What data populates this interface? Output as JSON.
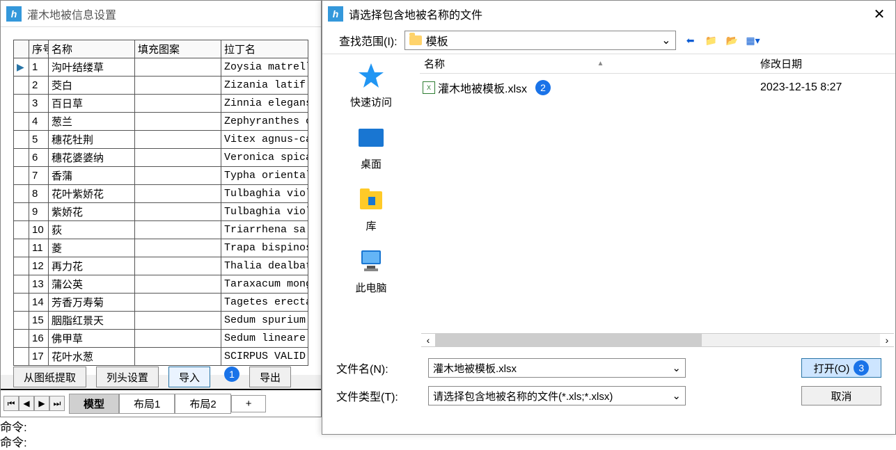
{
  "main_window": {
    "title": "灌木地被信息设置",
    "columns": {
      "index": "序号",
      "name": "名称",
      "fill": "填充图案",
      "latin": "拉丁名"
    },
    "rows": [
      {
        "idx": "1",
        "name": "沟叶结缕草",
        "latin": "Zoysia matrell"
      },
      {
        "idx": "2",
        "name": "茭白",
        "latin": "Zizania latif"
      },
      {
        "idx": "3",
        "name": "百日草",
        "latin": "Zinnia elegans"
      },
      {
        "idx": "4",
        "name": "葱兰",
        "latin": "Zephyranthes c"
      },
      {
        "idx": "5",
        "name": "穗花牡荆",
        "latin": "Vitex agnus-ca"
      },
      {
        "idx": "6",
        "name": "穗花婆婆纳",
        "latin": "Veronica spica"
      },
      {
        "idx": "7",
        "name": "香蒲",
        "latin": "Typha oriental"
      },
      {
        "idx": "8",
        "name": "花叶紫娇花",
        "latin": "Tulbaghia viol"
      },
      {
        "idx": "9",
        "name": "紫娇花",
        "latin": "Tulbaghia viol"
      },
      {
        "idx": "10",
        "name": "荻",
        "latin": "Triarrhena sa"
      },
      {
        "idx": "11",
        "name": "菱",
        "latin": "Trapa bispinos"
      },
      {
        "idx": "12",
        "name": "再力花",
        "latin": "Thalia dealbat"
      },
      {
        "idx": "13",
        "name": "蒲公英",
        "latin": "Taraxacum mong"
      },
      {
        "idx": "14",
        "name": "芳香万寿菊",
        "latin": "Tagetes erecta"
      },
      {
        "idx": "15",
        "name": "胭脂红景天",
        "latin": "Sedum spurium"
      },
      {
        "idx": "16",
        "name": "佛甲草",
        "latin": "Sedum lineare"
      },
      {
        "idx": "17",
        "name": "花叶水葱",
        "latin": "SCIRPUS VALID"
      }
    ],
    "buttons": {
      "extract": "从图纸提取",
      "columns": "列头设置",
      "import": "导入",
      "export": "导出"
    },
    "tabs": {
      "model": "模型",
      "layout1": "布局1",
      "layout2": "布局2",
      "add": "+"
    },
    "cmd": "命令:"
  },
  "file_dialog": {
    "title": "请选择包含地被名称的文件",
    "lookin_label": "查找范围(I):",
    "lookin_value": "模板",
    "columns": {
      "name": "名称",
      "date": "修改日期"
    },
    "files": [
      {
        "name": "灌木地被模板.xlsx",
        "date": "2023-12-15 8:27"
      }
    ],
    "sidebar": {
      "quick": "快速访问",
      "desktop": "桌面",
      "library": "库",
      "thispc": "此电脑"
    },
    "filename_label": "文件名(N):",
    "filename_value": "灌木地被模板.xlsx",
    "filetype_label": "文件类型(T):",
    "filetype_value": "请选择包含地被名称的文件(*.xls;*.xlsx)",
    "open": "打开(O)",
    "cancel": "取消"
  },
  "badges": {
    "one": "1",
    "two": "2",
    "three": "3"
  }
}
